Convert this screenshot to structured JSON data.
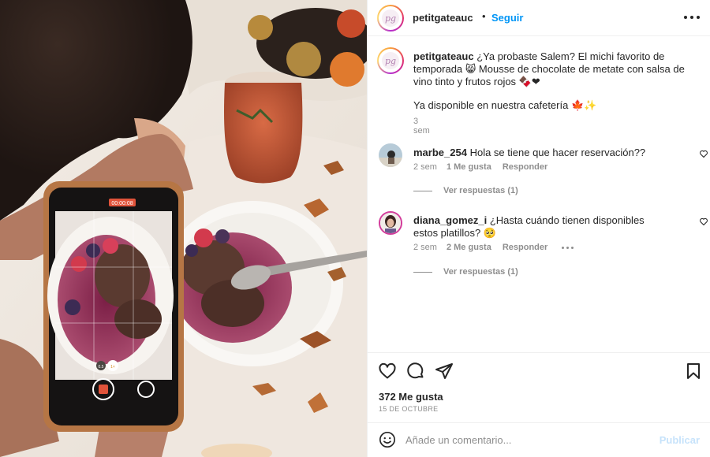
{
  "post": {
    "username": "petitgateauc",
    "separator": "•",
    "follow_label": "Seguir",
    "avatar_mark": "pg",
    "phone_timer": "00:00:08",
    "phone_zoom_1": "0.5",
    "phone_zoom_2": "1×"
  },
  "caption": {
    "username": "petitgateauc",
    "text": "¿Ya probaste Salem? El michi favorito de temporada 😸 Mousse de chocolate de metate con salsa de vino tinto y frutos rojos 🍫❤",
    "line2": "Ya disponible en nuestra cafetería 🍁✨",
    "time": "3 sem"
  },
  "comments": [
    {
      "username": "marbe_254",
      "text": "Hola se tiene que hacer reservación??",
      "time": "2 sem",
      "likes": "1 Me gusta",
      "reply": "Responder",
      "view_replies": "Ver respuestas (1)"
    },
    {
      "username": "diana_gomez_i",
      "text": "¿Hasta cuándo tienen disponibles estos platillos? 🥺",
      "time": "2 sem",
      "likes": "2 Me gusta",
      "reply": "Responder",
      "view_replies": "Ver respuestas (1)"
    }
  ],
  "footer": {
    "likes": "372 Me gusta",
    "date": "15 DE OCTUBRE",
    "comment_placeholder": "Añade un comentario...",
    "post_label": "Publicar"
  },
  "colors": {
    "link_blue": "#0095f6",
    "post_disabled": "#c7e3fb",
    "muted": "#8e8e8e"
  },
  "icons": [
    "heart-icon",
    "comment-icon",
    "share-icon",
    "bookmark-icon",
    "emoji-icon",
    "more-icon"
  ]
}
